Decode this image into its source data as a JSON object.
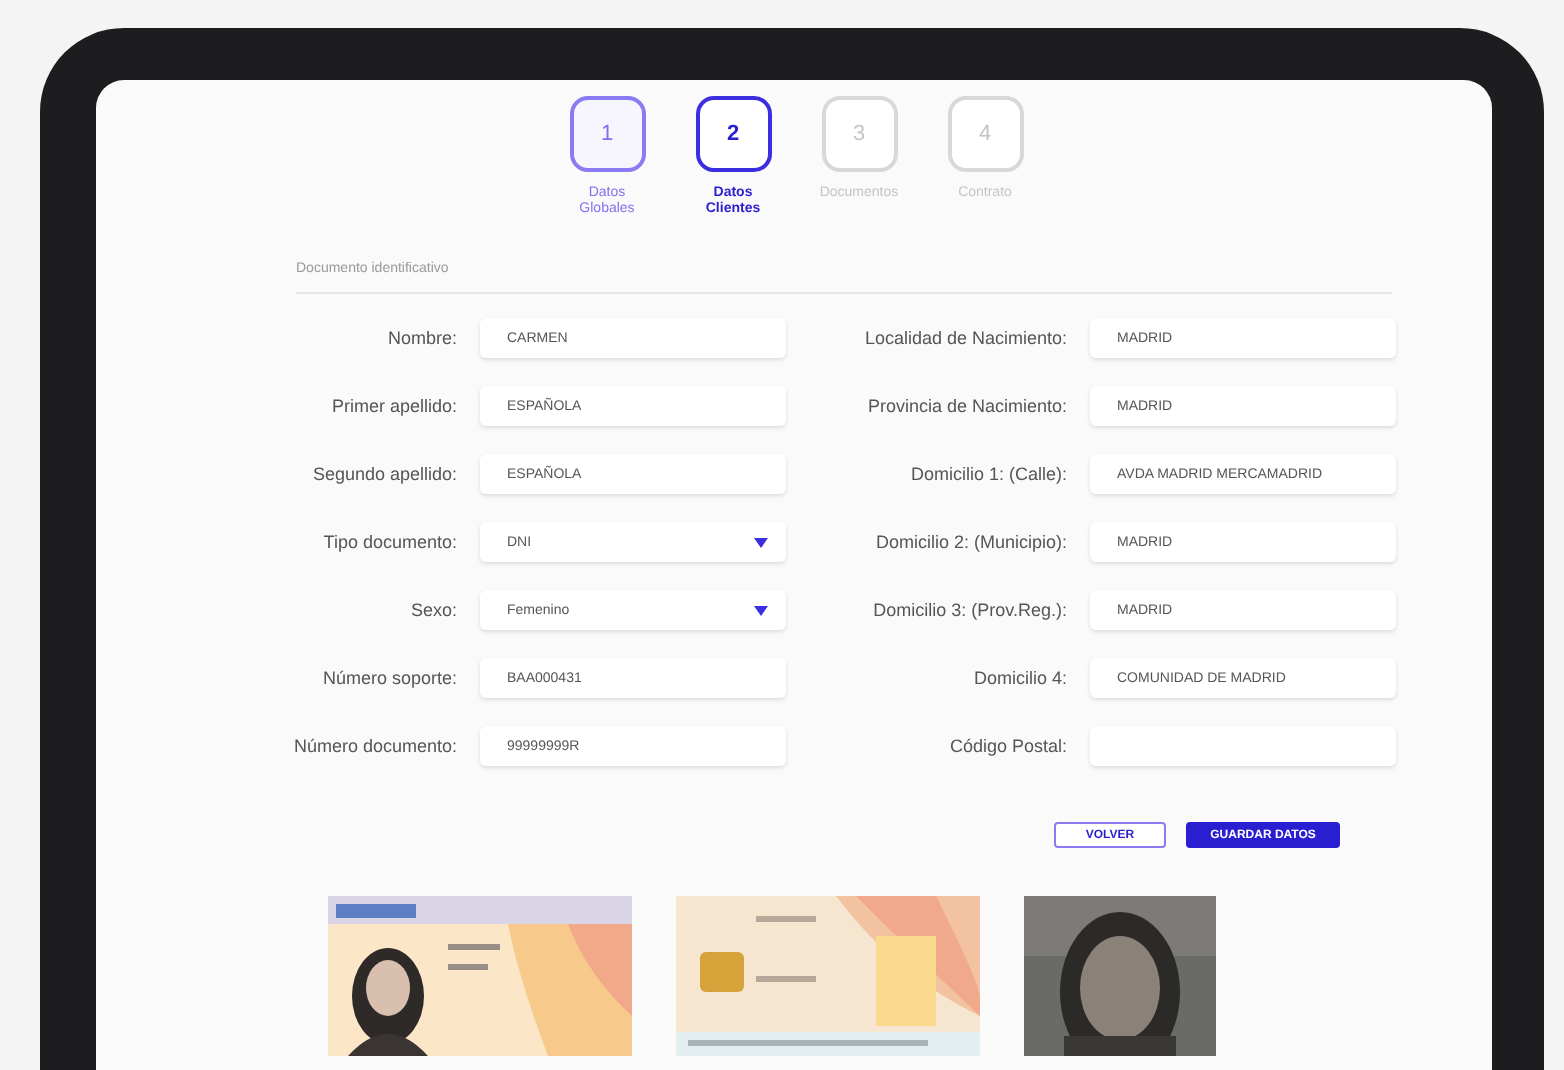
{
  "steps": [
    {
      "number": "1",
      "label": "Datos Globales",
      "selected": false,
      "completed": true
    },
    {
      "number": "2",
      "label": "Datos Clientes",
      "selected": true,
      "completed": false
    },
    {
      "number": "3",
      "label": "Documentos",
      "selected": false,
      "completed": false
    },
    {
      "number": "4",
      "label": "Contrato",
      "selected": false,
      "completed": false
    }
  ],
  "section_title": "Documento identificativo",
  "left_fields": [
    {
      "label": "Nombre:",
      "value": "CARMEN",
      "kind": "text"
    },
    {
      "label": "Primer apellido:",
      "value": "ESPAÑOLA",
      "kind": "text"
    },
    {
      "label": "Segundo apellido:",
      "value": "ESPAÑOLA",
      "kind": "text"
    },
    {
      "label": "Tipo documento:",
      "value": "DNI",
      "kind": "select"
    },
    {
      "label": "Sexo:",
      "value": "Femenino",
      "kind": "select"
    },
    {
      "label": "Número soporte:",
      "value": "BAA000431",
      "kind": "text"
    },
    {
      "label": "Número documento:",
      "value": "99999999R",
      "kind": "text"
    }
  ],
  "right_fields": [
    {
      "label": "Localidad de Nacimiento:",
      "value": "MADRID",
      "kind": "text"
    },
    {
      "label": "Provincia de Nacimiento:",
      "value": "MADRID",
      "kind": "text"
    },
    {
      "label": "Domicilio 1: (Calle):",
      "value": "AVDA MADRID MERCAMADRID",
      "kind": "text"
    },
    {
      "label": "Domicilio 2: (Municipio):",
      "value": "MADRID",
      "kind": "text"
    },
    {
      "label": "Domicilio 3: (Prov.Reg.):",
      "value": "MADRID",
      "kind": "text"
    },
    {
      "label": "Domicilio 4:",
      "value": "COMUNIDAD DE MADRID",
      "kind": "text"
    },
    {
      "label": "Código Postal:",
      "kind": "text"
    }
  ],
  "buttons": [
    {
      "label": "VOLVER",
      "kind": "secondary"
    },
    {
      "label": "GUARDAR DATOS",
      "kind": "primary"
    }
  ]
}
